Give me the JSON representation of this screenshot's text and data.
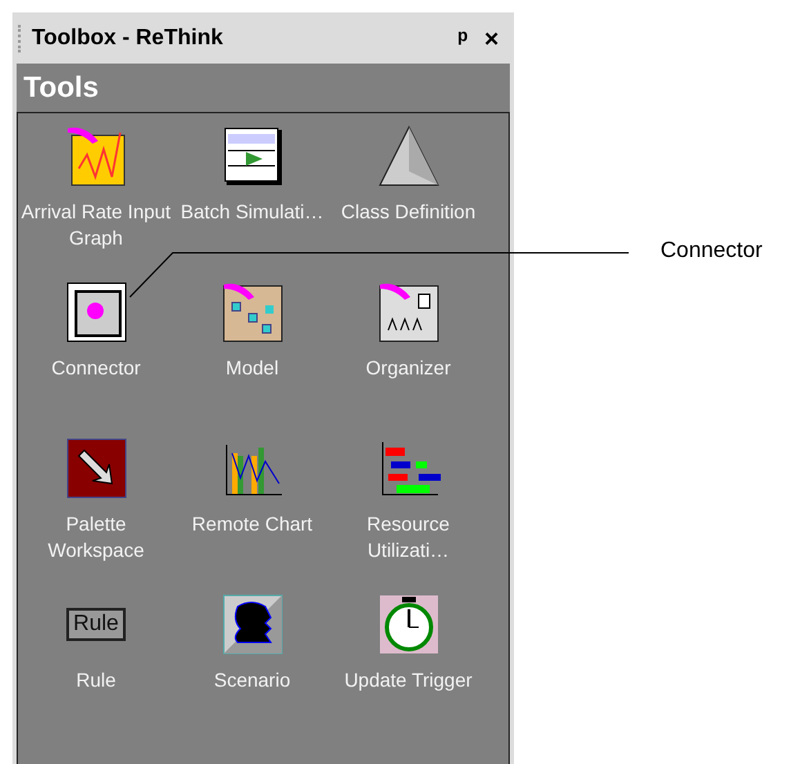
{
  "window": {
    "title": "Toolbox - ReThink",
    "pin": "ᵖ",
    "close": "×"
  },
  "section": {
    "title": "Tools"
  },
  "tools": [
    {
      "label": "Arrival Rate Input Graph"
    },
    {
      "label": "Batch Simulati…"
    },
    {
      "label": "Class Definition"
    },
    {
      "label": "Connector"
    },
    {
      "label": "Model"
    },
    {
      "label": "Organizer"
    },
    {
      "label": "Palette Workspace"
    },
    {
      "label": "Remote Chart"
    },
    {
      "label": "Resource Utilizati…"
    },
    {
      "label": "Rule",
      "icon_text": "Rule"
    },
    {
      "label": "Scenario"
    },
    {
      "label": "Update Trigger"
    }
  ],
  "callout": {
    "label": "Connector"
  }
}
